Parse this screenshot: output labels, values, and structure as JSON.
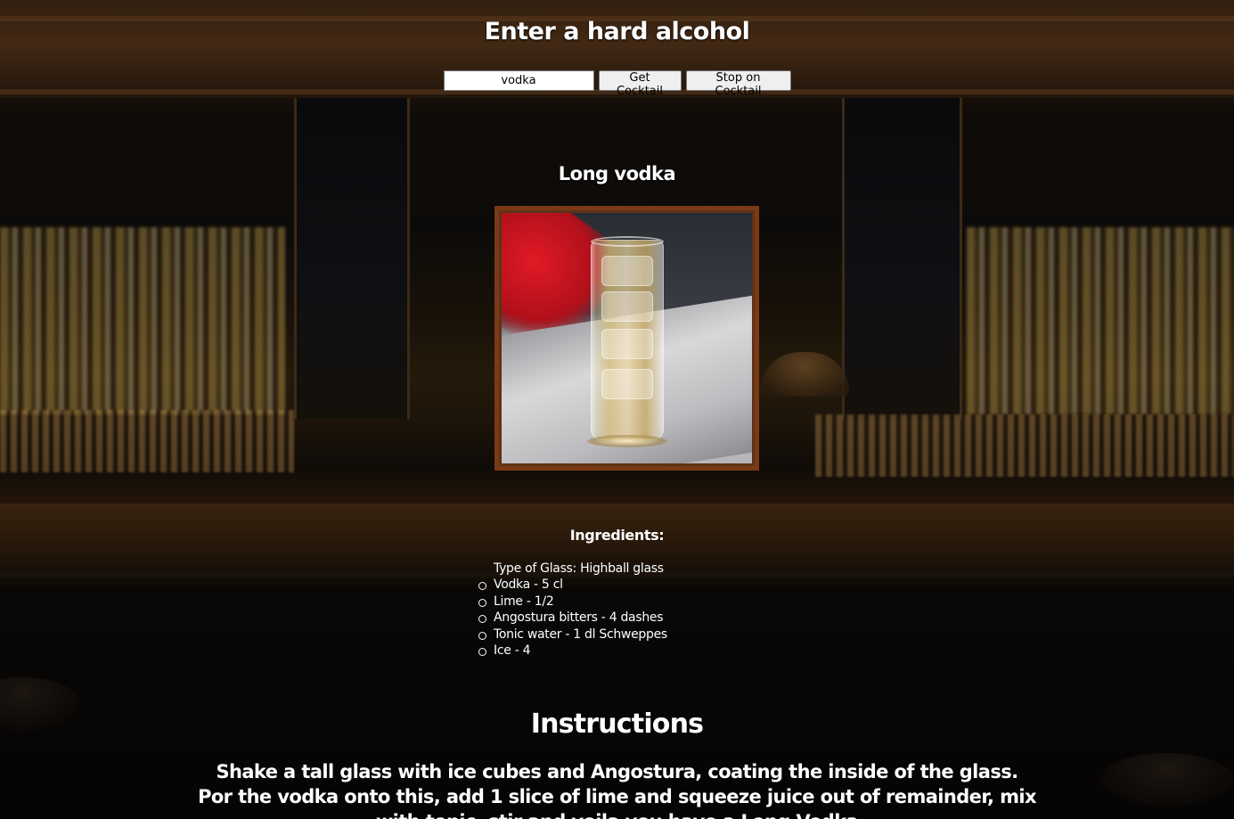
{
  "header": {
    "title": "Enter a hard alcohol"
  },
  "search": {
    "value": "vodka",
    "get_button_label": "Get Cocktail",
    "stop_button_label": "Stop on Cocktail"
  },
  "drink": {
    "name": "Long vodka",
    "ingredients_heading": "Ingredients:",
    "glass_type": "Type of Glass: Highball glass",
    "ingredients": [
      "Vodka - 5 cl",
      "Lime - 1/2",
      "Angostura bitters - 4 dashes",
      "Tonic water - 1 dl Schweppes",
      "Ice - 4"
    ],
    "instructions_heading": "Instructions",
    "instructions": "Shake a tall glass with ice cubes and Angostura, coating the inside of the glass. Por the vodka onto this, add 1 slice of lime and squeeze juice out of remainder, mix with tonic, stir and voila you have a Long Vodka"
  },
  "colors": {
    "photo_border": "#7a3a15",
    "text": "#ffffff"
  }
}
